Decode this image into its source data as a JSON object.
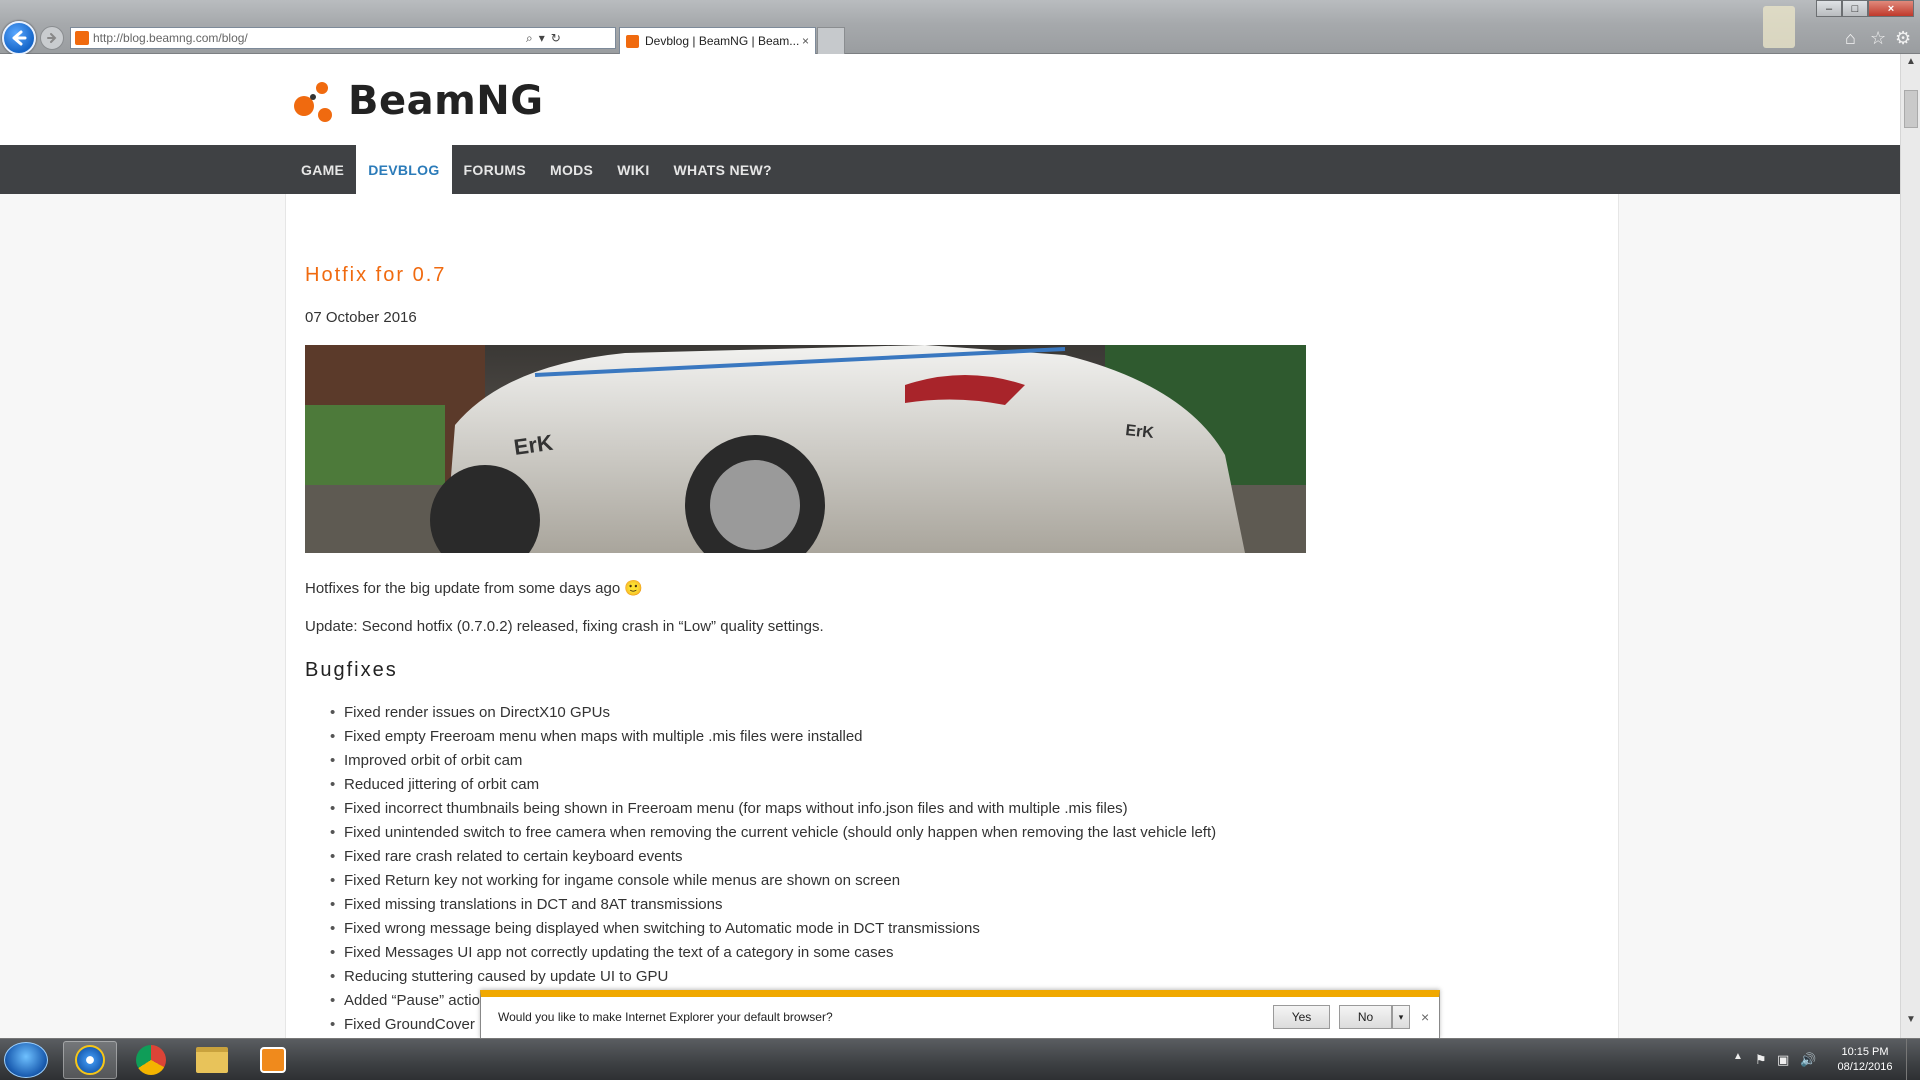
{
  "browser": {
    "url": "http://blog.beamng.com/blog/",
    "tab_title": "Devblog | BeamNG | Beam...",
    "tab_close": "×",
    "window_controls": {
      "minimize": "–",
      "maximize": "□",
      "close": "×"
    },
    "toolbar_icons": {
      "home": "⌂",
      "favorites": "☆",
      "tools": "⚙"
    },
    "address_icons": {
      "search": "⌕",
      "dropdown": "▾",
      "refresh": "↻"
    }
  },
  "site": {
    "logo_text": "BeamNG",
    "brand_color": "#f06a0f",
    "nav": [
      {
        "label": "GAME",
        "active": false
      },
      {
        "label": "DEVBLOG",
        "active": true
      },
      {
        "label": "FORUMS",
        "active": false
      },
      {
        "label": "MODS",
        "active": false
      },
      {
        "label": "WIKI",
        "active": false
      },
      {
        "label": "WHATS NEW?",
        "active": false
      }
    ]
  },
  "post": {
    "title": "Hotfix for 0.7",
    "date": "07 October 2016",
    "intro": "Hotfixes for the big update from some days ago 🙂",
    "update": "Update: Second hotfix (0.7.0.2) released, fixing crash in “Low” quality settings.",
    "bugfixes_heading": "Bugfixes",
    "bugfixes": [
      "Fixed render issues on DirectX10 GPUs",
      "Fixed empty Freeroam menu when maps with multiple .mis files were installed",
      "Improved orbit of orbit cam",
      "Reduced jittering of orbit cam",
      "Fixed incorrect thumbnails being shown in Freeroam menu (for maps without info.json files and with multiple .mis files)",
      "Fixed unintended switch to free camera when removing the current vehicle (should only happen when removing the last vehicle left)",
      "Fixed rare crash related to certain keyboard events",
      "Fixed Return key not working for ingame console while menus are shown on screen",
      "Fixed missing translations in DCT and 8AT transmissions",
      "Fixed wrong message being displayed when switching to Automatic mode in DCT transmissions",
      "Fixed Messages UI app not correctly updating the text of a category in some cases",
      "Reducing stuttering caused by update UI to GPU",
      "Added “Pause” actio",
      "Fixed GroundCover"
    ]
  },
  "notification": {
    "message": "Would you like to make Internet Explorer your default browser?",
    "yes_label": "Yes",
    "no_label": "No",
    "dropdown": "▾",
    "close": "×"
  },
  "taskbar": {
    "time": "10:15 PM",
    "date": "08/12/2016",
    "tray_up": "▲"
  }
}
